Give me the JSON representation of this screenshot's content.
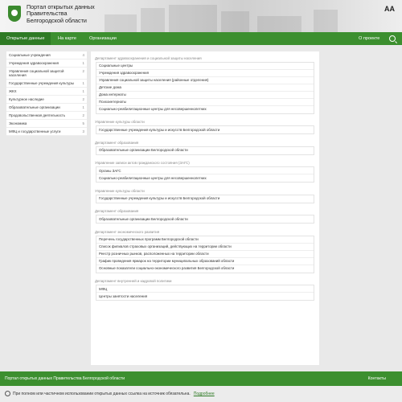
{
  "header": {
    "title_line1": "Портал открытых данных",
    "title_line2": "Правительства",
    "title_line3": "Белгородской области",
    "font_toggle": "AA"
  },
  "nav": {
    "items": [
      {
        "label": "Открытые данные"
      },
      {
        "label": "На карте"
      },
      {
        "label": "Организации"
      }
    ],
    "about": "О проекте",
    "search_icon": "search-icon"
  },
  "sidebar": {
    "items": [
      {
        "label": "Социальные учреждения",
        "count": "4"
      },
      {
        "label": "Учреждения здравоохранения",
        "count": "1"
      },
      {
        "label": "Управления социальной защитой населения",
        "count": "2"
      },
      {
        "label": "Государственные учреждения культуры",
        "count": "1"
      },
      {
        "label": "ЖКХ",
        "count": "1"
      },
      {
        "label": "Культурное наследие",
        "count": "2"
      },
      {
        "label": "Образовательные организации",
        "count": "1"
      },
      {
        "label": "Продовольственная деятельность",
        "count": "2"
      },
      {
        "label": "Экономика",
        "count": "5"
      },
      {
        "label": "МФЦ и государственные услуги",
        "count": "3"
      }
    ]
  },
  "sections": [
    {
      "title": "Департамент здравоохранения и социальной защиты населения",
      "items": [
        "Социальные центры",
        "Учреждения здравоохранения",
        "Управления социальной защиты населения (районные отделения)",
        "Детские дома",
        "Дома интернаты",
        "Психоинтернаты",
        "Социально-реабилитационные центры для несовершеннолетних"
      ]
    },
    {
      "title": "Управление культуры области",
      "items": [
        "Государственные учреждения культуры и искусств Белгородской области"
      ]
    },
    {
      "title": "Департамент образования",
      "items": [
        "Образовательные организации Белгородской области"
      ]
    },
    {
      "title": "Управление записи актов гражданского состояния (ЗАГС)",
      "items": [
        "Органы ЗАГС",
        "Социально-реабилитационные центры для несовершеннолетних"
      ]
    },
    {
      "title": "Управление культуры области",
      "items": [
        "Государственные учреждения культуры и искусств Белгородской области"
      ]
    },
    {
      "title": "Департамент образования",
      "items": [
        "Образовательные организации Белгородской области"
      ]
    },
    {
      "title": "Департамент экономического развития",
      "items": [
        "Перечень государственных программ Белгородской области",
        "Список филиалов страховых организаций, действующих на территории области",
        "Реестр розничных рынков, расположенных на территории области",
        "График проведения ярмарок на территории муниципальных образований области",
        "Основные показатели социально-экономического развития Белгородской области"
      ]
    },
    {
      "title": "Департамент внутренней и кадровой политики",
      "items": [
        "МФЦ",
        "Центры занятости населения"
      ]
    }
  ],
  "footer": {
    "left": "Портал открытых данных Правительства Белгородской области",
    "right": "Контакты"
  },
  "notice": {
    "text": "При полном или частичном использовании открытых данных ссылка на источник обязательна.",
    "link": "Подробнее"
  },
  "colors": {
    "accent": "#3c8f2f",
    "accent_dark": "#2e7a24"
  }
}
